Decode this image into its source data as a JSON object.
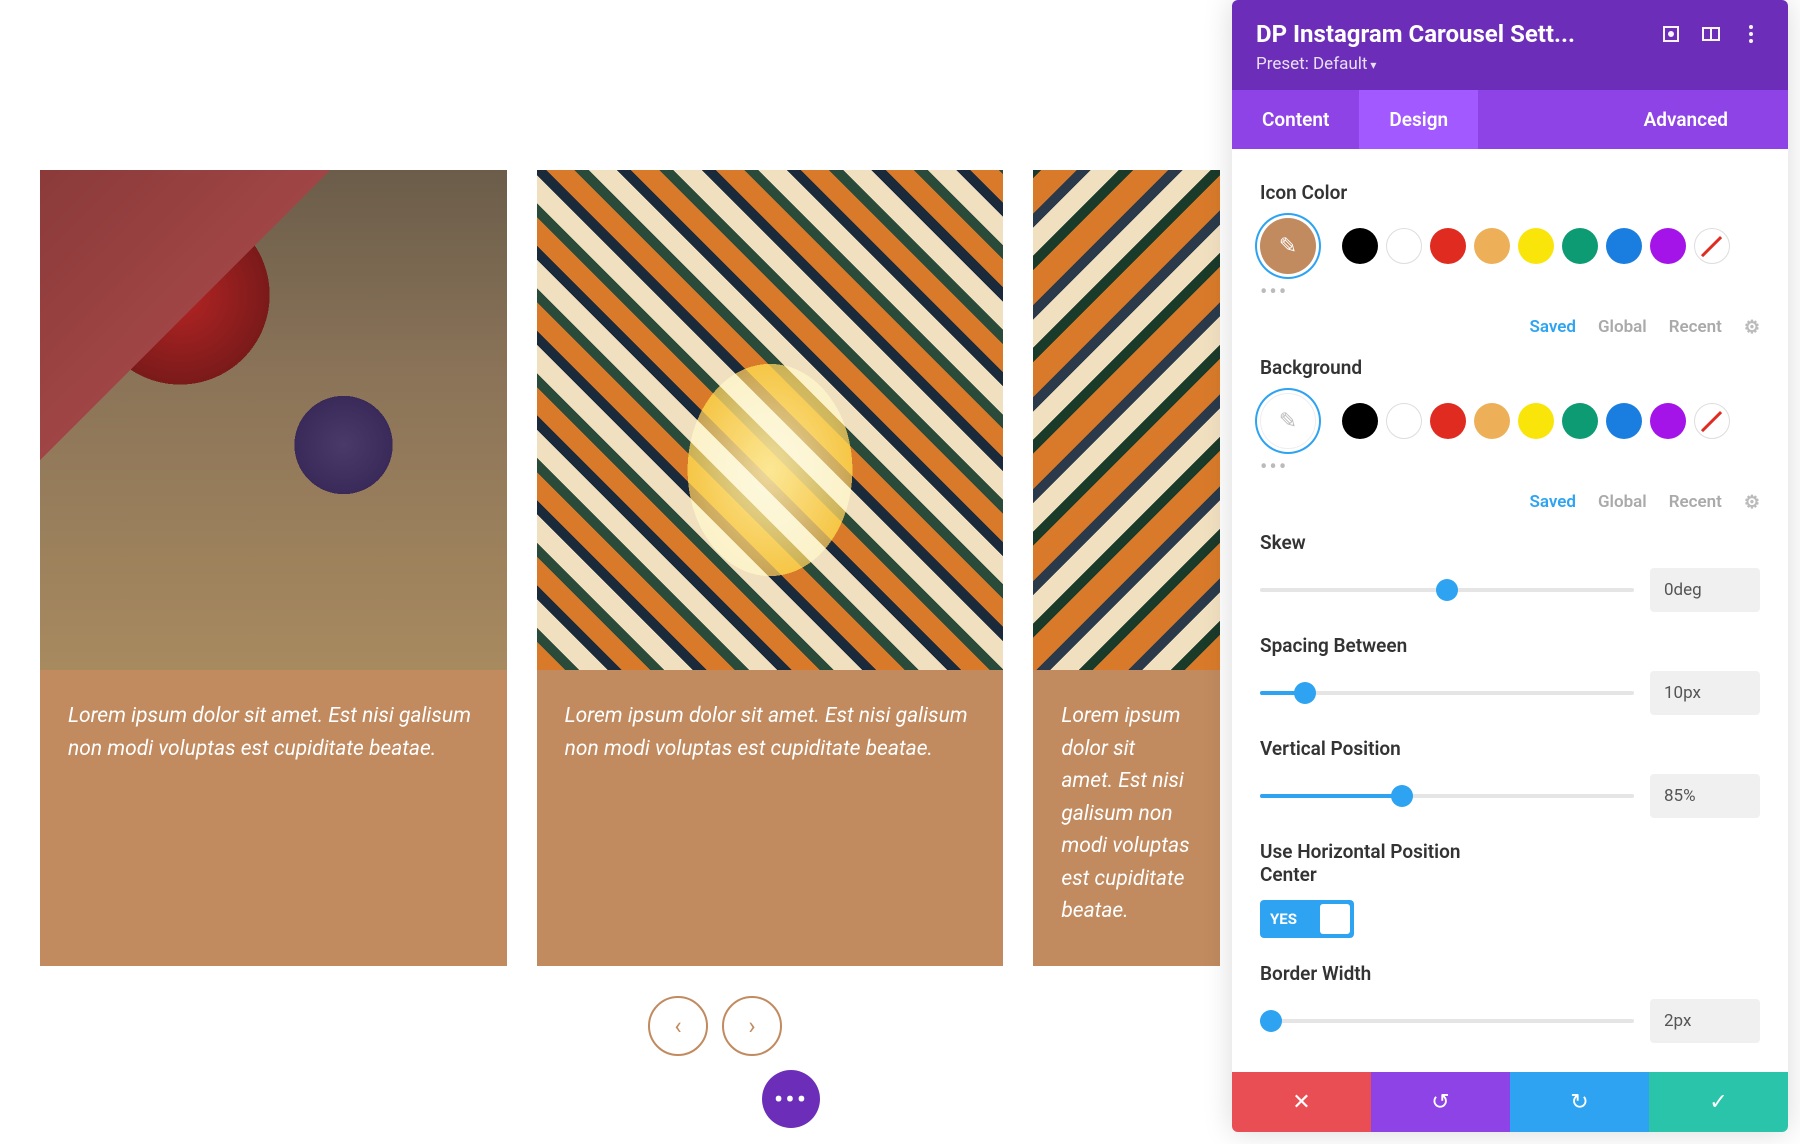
{
  "carousel": {
    "cards": [
      {
        "caption": "Lorem ipsum dolor sit amet. Est nisi galisum non modi voluptas est cupiditate beatae."
      },
      {
        "caption": "Lorem ipsum dolor sit amet. Est nisi galisum non modi voluptas est cupiditate beatae."
      },
      {
        "caption": "Lorem ipsum dolor sit amet. Est nisi galisum non modi voluptas est cupiditate beatae."
      }
    ]
  },
  "panel": {
    "title": "DP Instagram Carousel Sett...",
    "preset": "Preset: Default",
    "tabs": {
      "content": "Content",
      "design": "Design",
      "advanced": "Advanced"
    },
    "icon_color_label": "Icon Color",
    "background_label": "Background",
    "color_tabs": {
      "saved": "Saved",
      "global": "Global",
      "recent": "Recent"
    },
    "icon_color_selected": "#c18a5f",
    "background_selected": "#ffffff",
    "palette": [
      "black",
      "white",
      "red",
      "orange",
      "yellow",
      "green",
      "blue",
      "purple",
      "none"
    ],
    "skew": {
      "label": "Skew",
      "value": "0deg",
      "pct": 50
    },
    "spacing": {
      "label": "Spacing Between",
      "value": "10px",
      "pct": 12
    },
    "vpos": {
      "label": "Vertical Position",
      "value": "85%",
      "pct": 38
    },
    "hcenter": {
      "label": "Use Horizontal Position Center",
      "value": "YES"
    },
    "border": {
      "label": "Border Width",
      "value": "2px",
      "pct": 3
    }
  }
}
